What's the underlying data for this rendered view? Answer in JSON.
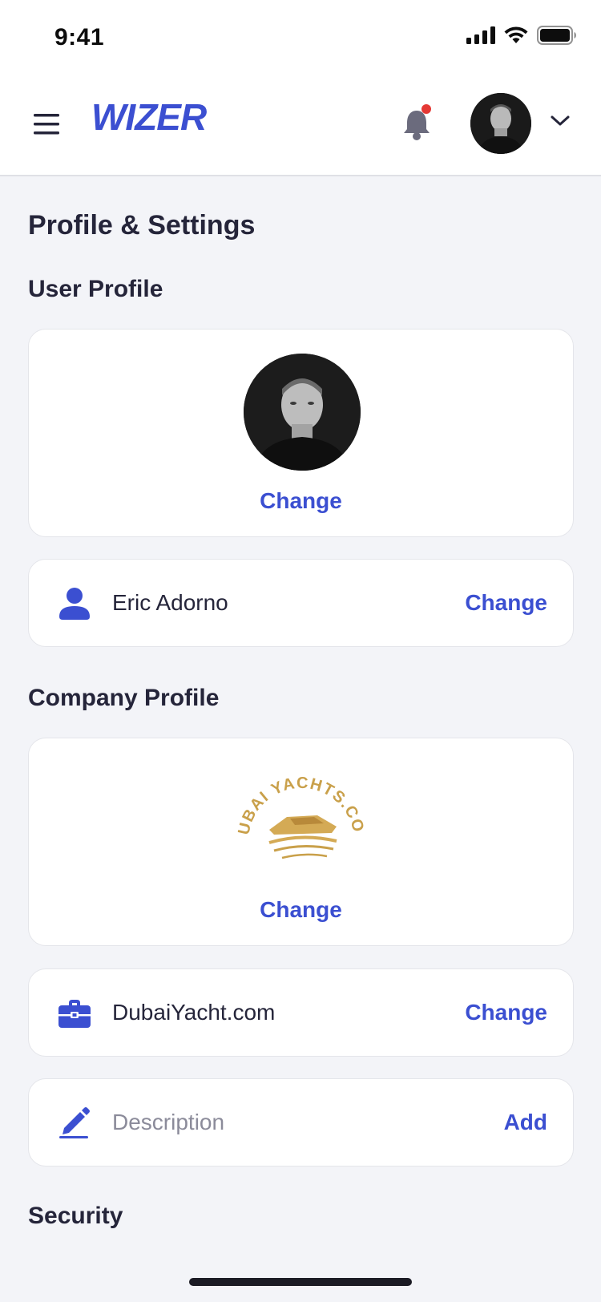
{
  "status_bar": {
    "time": "9:41"
  },
  "header": {
    "logo_text": "WIZER",
    "brand_color": "#3b4fd1",
    "notification_dot_color": "#e53935"
  },
  "page": {
    "title": "Profile & Settings"
  },
  "user_profile": {
    "section_title": "User Profile",
    "photo_action": "Change",
    "name": "Eric Adorno",
    "name_action": "Change"
  },
  "company_profile": {
    "section_title": "Company Profile",
    "logo_text": "DUBAI YACHTS.COM",
    "logo_action": "Change",
    "company_name": "DubaiYacht.com",
    "company_action": "Change",
    "description_placeholder": "Description",
    "description_action": "Add"
  },
  "security": {
    "section_title": "Security"
  },
  "icons": {
    "menu": "menu-icon",
    "bell": "bell-icon",
    "chevron": "chevron-down-icon",
    "user": "user-icon",
    "briefcase": "briefcase-icon",
    "pencil": "pencil-icon"
  }
}
